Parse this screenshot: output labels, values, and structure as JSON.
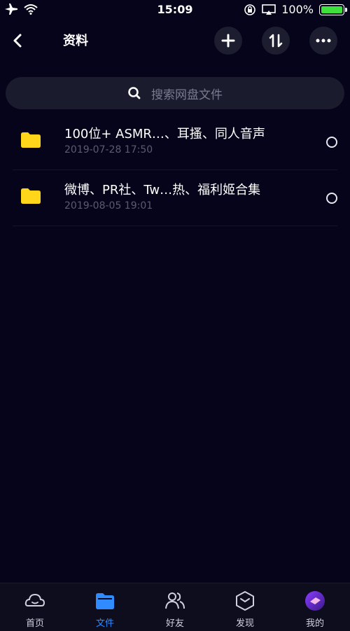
{
  "status_bar": {
    "time": "15:09",
    "battery_text": "100%",
    "battery_level": 1.0
  },
  "header": {
    "title": "资料"
  },
  "search": {
    "placeholder": "搜索网盘文件"
  },
  "files": [
    {
      "name": "100位+ ASMR…、耳搔、同人音声",
      "date": "2019-07-28 17:50"
    },
    {
      "name": "微博、PR社、Tw…热、福利姬合集",
      "date": "2019-08-05 19:01"
    }
  ],
  "tabs": [
    {
      "label": "首页",
      "icon": "cloud-home-icon"
    },
    {
      "label": "文件",
      "icon": "folder-icon",
      "active": true
    },
    {
      "label": "好友",
      "icon": "friends-icon"
    },
    {
      "label": "发现",
      "icon": "discover-icon"
    },
    {
      "label": "我的",
      "icon": "avatar-icon"
    }
  ],
  "colors": {
    "background": "#05041a",
    "accent": "#2f8bff",
    "folder": "#ffd61a",
    "battery": "#3ee03b"
  }
}
